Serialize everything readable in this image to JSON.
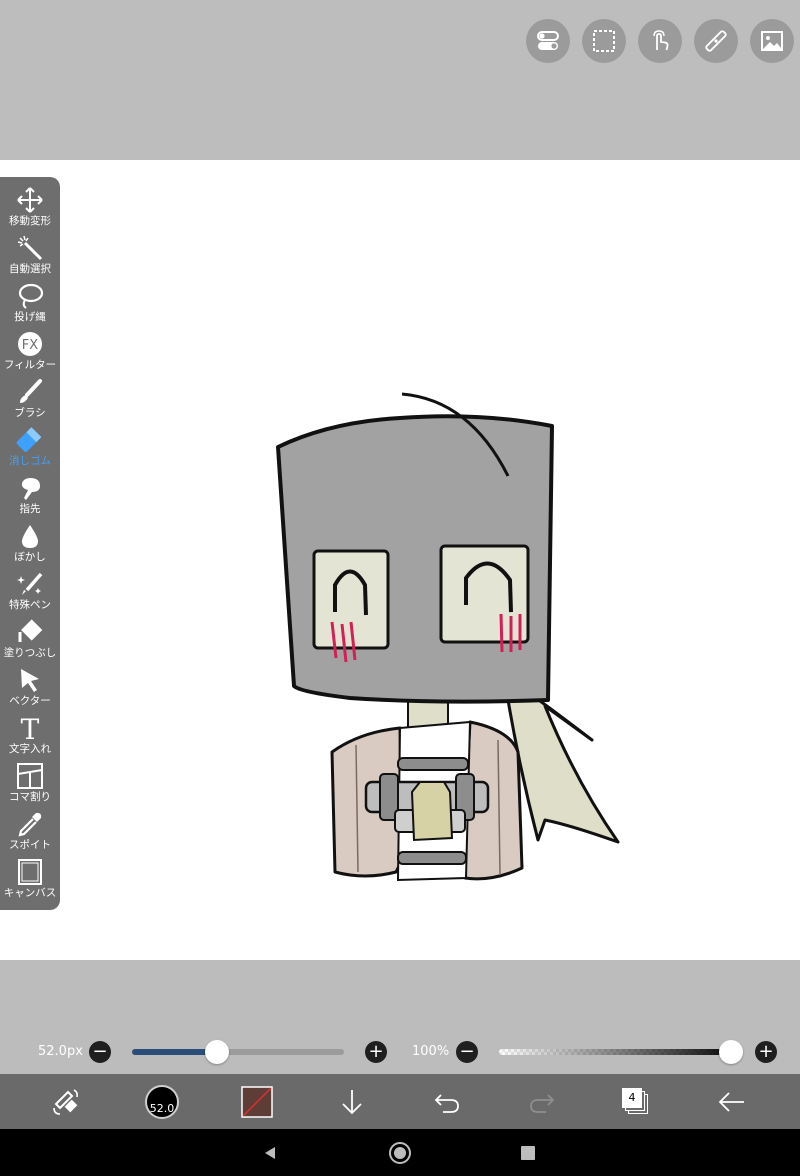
{
  "top_buttons": [
    "settings-toggle-icon",
    "selection-icon",
    "gesture-icon",
    "ruler-icon",
    "image-icon"
  ],
  "tools": [
    {
      "label": "移動変形",
      "icon": "move-icon"
    },
    {
      "label": "自動選択",
      "icon": "magic-wand-icon"
    },
    {
      "label": "投げ縄",
      "icon": "lasso-icon"
    },
    {
      "label": "フィルター",
      "icon": "fx-icon"
    },
    {
      "label": "ブラシ",
      "icon": "brush-icon"
    },
    {
      "label": "消しゴム",
      "icon": "eraser-icon",
      "active": true
    },
    {
      "label": "指先",
      "icon": "smudge-icon"
    },
    {
      "label": "ぼかし",
      "icon": "blur-drop-icon"
    },
    {
      "label": "特殊ペン",
      "icon": "special-pen-icon"
    },
    {
      "label": "塗りつぶし",
      "icon": "fill-bucket-icon"
    },
    {
      "label": "ベクター",
      "icon": "vector-arrow-icon"
    },
    {
      "label": "文字入れ",
      "icon": "text-icon"
    },
    {
      "label": "コマ割り",
      "icon": "frame-divide-icon"
    },
    {
      "label": "スポイト",
      "icon": "eyedropper-icon"
    },
    {
      "label": "キャンバス",
      "icon": "canvas-icon"
    }
  ],
  "brush_size": {
    "label": "52.0px",
    "value": 52.0,
    "fraction": 0.4
  },
  "opacity": {
    "label": "100%",
    "value": 100,
    "fraction": 1.0
  },
  "bottom_bar": {
    "brush_size_badge": "52.0",
    "layer_count": "4"
  },
  "colors": {
    "accent_active": "#3ea0ff",
    "size_track_fill": "#2a4e79",
    "panel_bg": "#6e6e6e"
  }
}
